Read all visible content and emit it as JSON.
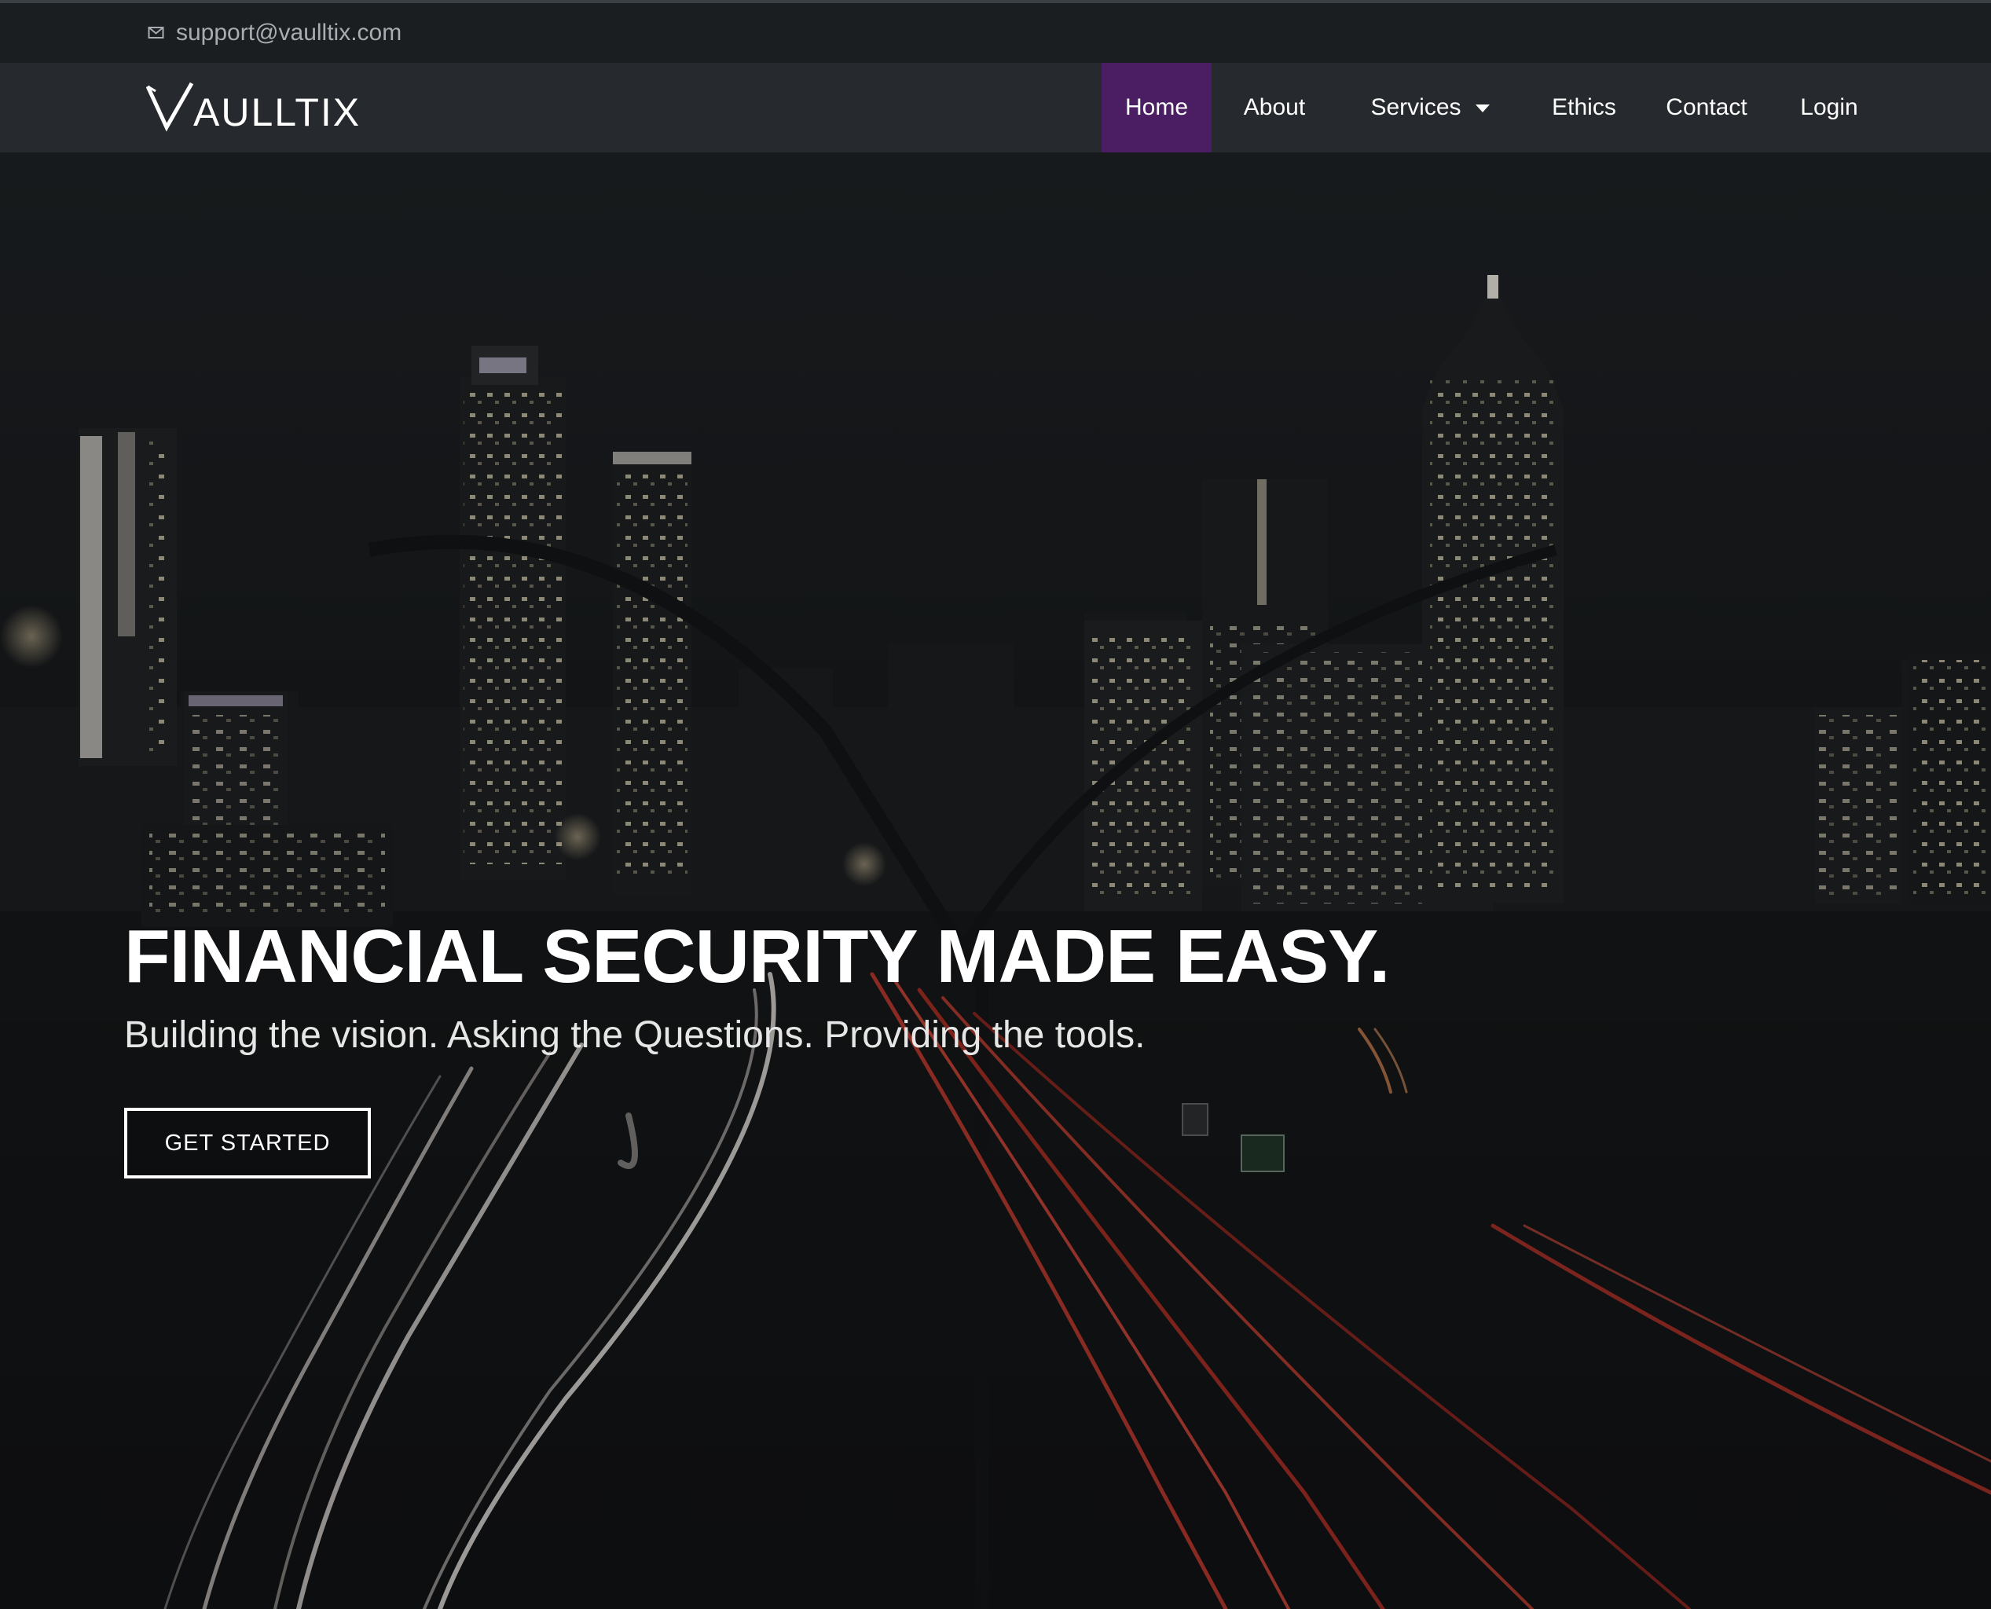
{
  "topbar": {
    "email": "support@vaulltix.com",
    "icon": "envelope-icon"
  },
  "brand": {
    "logo_text": "VAULLTIX",
    "logo_text_rest": "AULLTIX"
  },
  "nav": {
    "items": [
      {
        "label": "Home",
        "active": true
      },
      {
        "label": "About",
        "active": false
      },
      {
        "label": "Services",
        "active": false,
        "dropdown": true
      },
      {
        "label": "Ethics",
        "active": false
      },
      {
        "label": "Contact",
        "active": false
      },
      {
        "label": "Login",
        "active": false
      }
    ],
    "active_color": "#4b1e63"
  },
  "hero": {
    "title": "FINANCIAL SECURITY MADE EASY.",
    "subtitle": "Building the vision. Asking the Questions. Providing the tools.",
    "cta_label": "GET STARTED"
  },
  "colors": {
    "topbar_bg": "#1b1e21",
    "navbar_bg": "#26292d",
    "accent": "#4b1e63",
    "text": "#ffffff"
  }
}
